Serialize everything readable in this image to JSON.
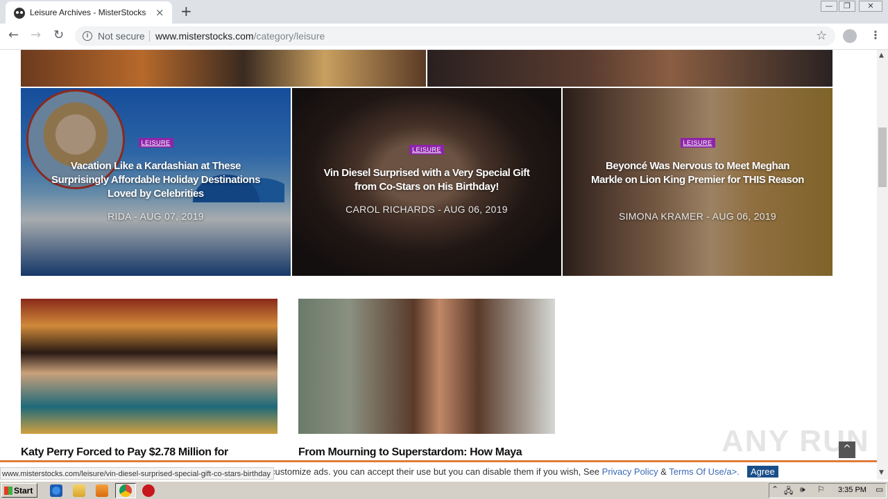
{
  "browser": {
    "tab_title": "Leisure Archives - MisterStocks",
    "tab_close": "×",
    "new_tab": "+",
    "win_minimize": "—",
    "win_restore": "❐",
    "win_close": "✕",
    "back": "←",
    "forward": "→",
    "reload": "↻",
    "security_label": "Not secure",
    "url_host": "www.misterstocks.com",
    "url_path": "/category/leisure",
    "star": "☆",
    "menu": "⋮",
    "status_url": "www.misterstocks.com/leisure/vin-diesel-surprised-special-gift-co-stars-birthday"
  },
  "featured": [
    {
      "category": "LEISURE",
      "title": "Vacation Like a Kardashian at These Surprisingly Affordable Holiday Destinations Loved by Celebrities",
      "meta": "RIDA - AUG 07, 2019",
      "image": "santorini-kardashian-photo"
    },
    {
      "category": "LEISURE",
      "title": "Vin Diesel Surprised with a Very Special Gift from Co-Stars on His Birthday!",
      "meta": "CAROL RICHARDS - AUG 06, 2019",
      "image": "vin-diesel-photo"
    },
    {
      "category": "LEISURE",
      "title": "Beyoncé Was Nervous to Meet Meghan Markle on Lion King Premier for THIS Reason",
      "meta": "SIMONA KRAMER - AUG 06, 2019",
      "image": "beyonce-meghan-photo"
    }
  ],
  "posts": [
    {
      "title": "Katy Perry Forced to Pay $2.78 Million for",
      "image": "katy-perry-photo"
    },
    {
      "title": "From Mourning to Superstardom: How Maya",
      "image": "maya-rudolph-photo"
    }
  ],
  "watermark": "ANY RUN",
  "scroll_top": "^",
  "cookie": {
    "text": "customize ads. you can accept their use but you can disable them if you wish, See",
    "privacy_link": "Privacy Policy",
    "amp": "&",
    "terms_link": "Terms Of Use/a>.",
    "agree": "Agree"
  },
  "taskbar": {
    "start": "Start",
    "clock": "3:35 PM"
  },
  "colors": {
    "category_badge": "#8e24aa",
    "cookie_border": "#e07b39",
    "agree_button": "#1a4e8a",
    "link": "#3a68b5"
  }
}
